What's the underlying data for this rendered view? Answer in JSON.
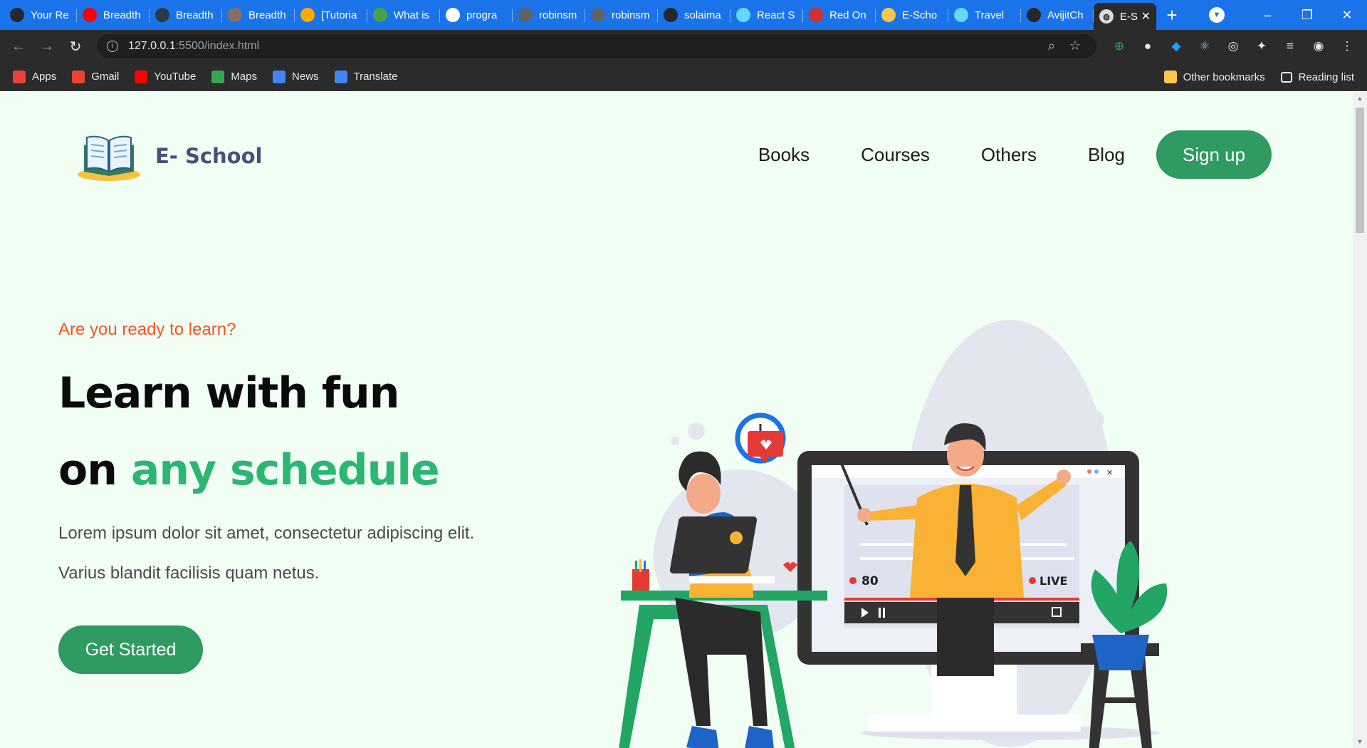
{
  "browser": {
    "tabs": [
      {
        "label": "Your Re",
        "icon": "github-icon",
        "color": "#24292e"
      },
      {
        "label": "Breadth",
        "icon": "youtube-icon",
        "color": "#ff0000"
      },
      {
        "label": "Breadth",
        "icon": "hackerrank-icon",
        "color": "#2b3a4a"
      },
      {
        "label": "Breadth",
        "icon": "avatar-icon",
        "color": "#8d6e63"
      },
      {
        "label": "[Tutoria",
        "icon": "chart-icon",
        "color": "#f9ab00"
      },
      {
        "label": "What is",
        "icon": "leaf-icon",
        "color": "#47a248"
      },
      {
        "label": "progra",
        "icon": "google-icon",
        "color": "#ffffff"
      },
      {
        "label": "robinsm",
        "icon": "link-icon",
        "color": "#5f6368"
      },
      {
        "label": "robinsm",
        "icon": "link-icon",
        "color": "#5f6368"
      },
      {
        "label": "solaima",
        "icon": "github-icon",
        "color": "#24292e"
      },
      {
        "label": "React S",
        "icon": "react-icon",
        "color": "#61dafb"
      },
      {
        "label": "Red On",
        "icon": "redonion-icon",
        "color": "#d32f2f"
      },
      {
        "label": "E-Scho",
        "icon": "eschool-icon",
        "color": "#f2c94c"
      },
      {
        "label": "Travel",
        "icon": "react-icon",
        "color": "#61dafb"
      },
      {
        "label": "AvijitCh",
        "icon": "github-icon",
        "color": "#24292e"
      }
    ],
    "active_tab": {
      "label": "E-S",
      "icon": "globe-icon"
    },
    "url_host": "127.0.0.1",
    "url_path": ":5500/index.html",
    "bookmarks": [
      {
        "label": "Apps",
        "icon": "apps-grid-icon",
        "color": "#ea4335"
      },
      {
        "label": "Gmail",
        "icon": "gmail-icon",
        "color": "#ea4335"
      },
      {
        "label": "YouTube",
        "icon": "youtube-icon",
        "color": "#ff0000"
      },
      {
        "label": "Maps",
        "icon": "maps-icon",
        "color": "#34a853"
      },
      {
        "label": "News",
        "icon": "news-icon",
        "color": "#4285f4"
      },
      {
        "label": "Translate",
        "icon": "translate-icon",
        "color": "#4285f4"
      }
    ],
    "other_bookmarks": "Other bookmarks",
    "reading_list": "Reading list"
  },
  "site": {
    "logo_text": "E- School",
    "nav": [
      "Books",
      "Courses",
      "Others",
      "Blog"
    ],
    "signup": "Sign up"
  },
  "hero": {
    "kicker": "Are you ready to learn?",
    "title_line1": "Learn with fun",
    "title_line2_prefix": "on ",
    "title_line2_accent": "any schedule",
    "paragraph": "Lorem ipsum dolor sit amet, consectetur adipiscing elit. Varius blandit facilisis quam netus.",
    "cta": "Get Started",
    "video_viewers": "80",
    "video_live": "LIVE"
  },
  "colors": {
    "brand_green": "#2f9a62",
    "accent_green": "#2bb673",
    "kicker_orange": "#f05423",
    "page_bg": "#f1fef3",
    "chrome_blue": "#1a73e8"
  }
}
